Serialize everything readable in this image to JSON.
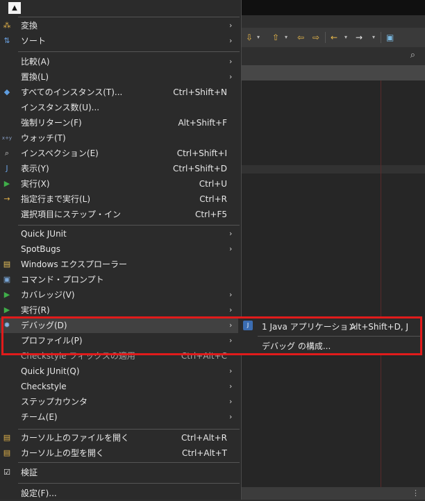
{
  "menu": {
    "items": [
      {
        "label": "変換",
        "accel": "",
        "submenu": true,
        "icon": "convert-icon",
        "icon_color": "#e2b24a"
      },
      {
        "label": "ソート",
        "accel": "",
        "submenu": true,
        "icon": "sort-icon",
        "icon_color": "#6aa0e0"
      },
      {
        "label": "比較(A)",
        "accel": "",
        "submenu": true,
        "icon": "",
        "icon_color": ""
      },
      {
        "label": "置換(L)",
        "accel": "",
        "submenu": true,
        "icon": "",
        "icon_color": ""
      },
      {
        "label": "すべてのインスタンス(T)...",
        "accel": "Ctrl+Shift+N",
        "submenu": false,
        "icon": "instances-icon",
        "icon_color": "#5f9ee0"
      },
      {
        "label": "インスタンス数(U)...",
        "accel": "",
        "submenu": false,
        "icon": "",
        "icon_color": ""
      },
      {
        "label": "強制リターン(F)",
        "accel": "Alt+Shift+F",
        "submenu": false,
        "icon": "",
        "icon_color": ""
      },
      {
        "label": "ウォッチ(T)",
        "accel": "",
        "submenu": false,
        "icon": "watch-icon",
        "icon_color": "#8aa0c8"
      },
      {
        "label": "インスペクション(E)",
        "accel": "Ctrl+Shift+I",
        "submenu": false,
        "icon": "inspect-icon",
        "icon_color": "#d0d0d0"
      },
      {
        "label": "表示(Y)",
        "accel": "Ctrl+Shift+D",
        "submenu": false,
        "icon": "display-icon",
        "icon_color": "#6aa0e0"
      },
      {
        "label": "実行(X)",
        "accel": "Ctrl+U",
        "submenu": false,
        "icon": "execute-icon",
        "icon_color": "#3fae49"
      },
      {
        "label": "指定行まで実行(L)",
        "accel": "Ctrl+R",
        "submenu": false,
        "icon": "run-to-line-icon",
        "icon_color": "#e2b24a"
      },
      {
        "label": "選択項目にステップ・イン",
        "accel": "Ctrl+F5",
        "submenu": false,
        "icon": "",
        "icon_color": ""
      },
      {
        "label": "Quick JUnit",
        "accel": "",
        "submenu": true,
        "icon": "",
        "icon_color": ""
      },
      {
        "label": "SpotBugs",
        "accel": "",
        "submenu": true,
        "icon": "",
        "icon_color": ""
      },
      {
        "label": "Windows エクスプローラー",
        "accel": "",
        "submenu": false,
        "icon": "folder-icon",
        "icon_color": "#e8c25a"
      },
      {
        "label": "コマンド・プロンプト",
        "accel": "",
        "submenu": false,
        "icon": "terminal-icon",
        "icon_color": "#7aa7d8"
      },
      {
        "label": "カバレッジ(V)",
        "accel": "",
        "submenu": true,
        "icon": "coverage-icon",
        "icon_color": "#3fae49"
      },
      {
        "label": "実行(R)",
        "accel": "",
        "submenu": true,
        "icon": "run-icon",
        "icon_color": "#3fae49"
      },
      {
        "label": "デバッグ(D)",
        "accel": "",
        "submenu": true,
        "icon": "debug-icon",
        "icon_color": "#8ab4e0"
      },
      {
        "label": "プロファイル(P)",
        "accel": "",
        "submenu": true,
        "icon": "",
        "icon_color": ""
      },
      {
        "label": "Checkstyle フィックスの適用",
        "accel": "Ctrl+Alt+C",
        "submenu": false,
        "icon": "",
        "icon_color": ""
      },
      {
        "label": "Quick JUnit(Q)",
        "accel": "",
        "submenu": true,
        "icon": "",
        "icon_color": ""
      },
      {
        "label": "Checkstyle",
        "accel": "",
        "submenu": true,
        "icon": "",
        "icon_color": ""
      },
      {
        "label": "ステップカウンタ",
        "accel": "",
        "submenu": true,
        "icon": "",
        "icon_color": ""
      },
      {
        "label": "チーム(E)",
        "accel": "",
        "submenu": true,
        "icon": "",
        "icon_color": ""
      },
      {
        "label": "カーソル上のファイルを開く",
        "accel": "Ctrl+Alt+R",
        "submenu": false,
        "icon": "open-file-icon",
        "icon_color": "#e2b24a"
      },
      {
        "label": "カーソル上の型を開く",
        "accel": "Ctrl+Alt+T",
        "submenu": false,
        "icon": "open-type-icon",
        "icon_color": "#e2b24a"
      },
      {
        "label": "検証",
        "accel": "",
        "submenu": false,
        "icon": "checkbox-icon",
        "icon_color": "#e8e8e8"
      },
      {
        "label": "設定(F)...",
        "accel": "",
        "submenu": false,
        "icon": "",
        "icon_color": ""
      }
    ]
  },
  "submenu": {
    "items": [
      {
        "label": "1 Java アプリケーション",
        "accel": "Alt+Shift+D, J",
        "icon": "java-app-icon"
      },
      {
        "label": "デバッグ の構成...",
        "accel": ""
      }
    ]
  },
  "colors": {
    "highlight": "#414141",
    "annotation": "#e11b1b",
    "accent": "#e8b84a"
  }
}
